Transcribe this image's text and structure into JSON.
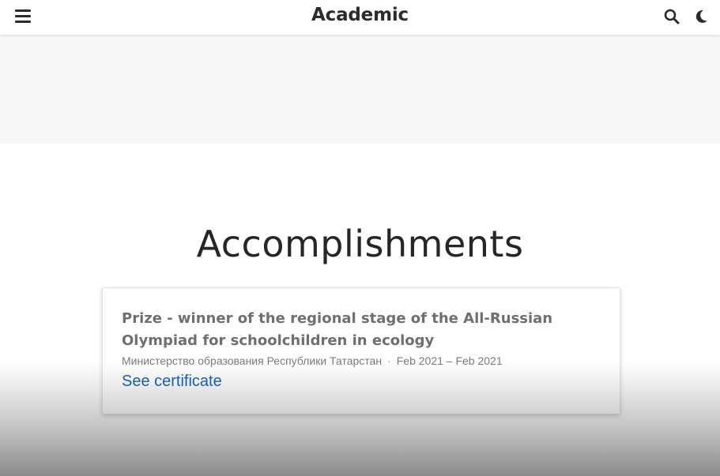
{
  "navbar": {
    "brand": "Academic",
    "menu_icon": "hamburger-menu-icon",
    "search_icon": "search-icon",
    "theme_icon": "moon-icon"
  },
  "section": {
    "title": "Accomplishments"
  },
  "accomplishment": {
    "title": "Prize - winner of the regional stage of the All-Russian Olympiad for schoolchildren in ecology",
    "organization": "Министерство образования Республики Татарстан",
    "separator": "·",
    "date_range": "Feb 2021 – Feb 2021",
    "link_label": "See certificate"
  },
  "colors": {
    "link": "#1565c0",
    "text_dark": "#262626",
    "card_title": "#6f6f6f",
    "hero_band": "#f7f7f7"
  }
}
